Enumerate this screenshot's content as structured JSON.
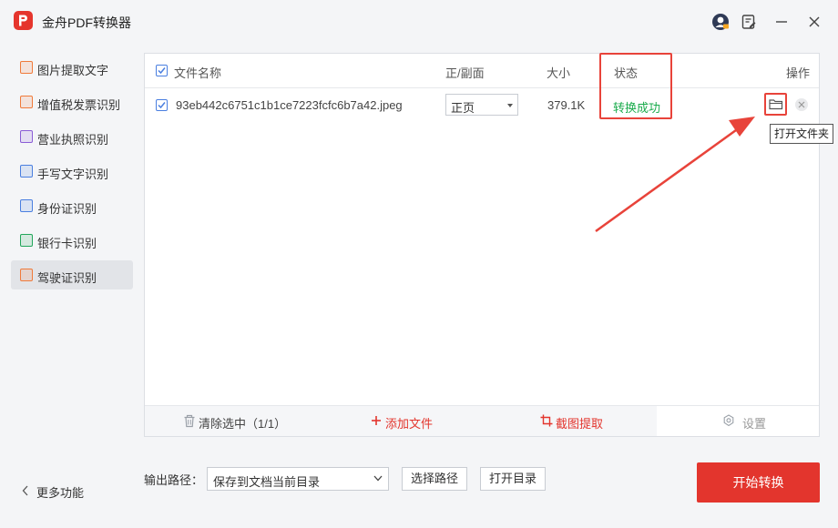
{
  "app": {
    "title": "金舟PDF转换器"
  },
  "colors": {
    "accent": "#e3352d",
    "success": "#1aab4c",
    "checkbox": "#4a7fe0",
    "annotation": "#e8433a"
  },
  "titlebar": {
    "icons": [
      "avatar-icon",
      "feedback-icon",
      "minimize-icon",
      "close-icon"
    ]
  },
  "sidebar": {
    "items": [
      {
        "label": "图片提取文字",
        "icon": "image-text-icon",
        "color": "#f07a3a"
      },
      {
        "label": "增值税发票识别",
        "icon": "invoice-icon",
        "color": "#f07a3a"
      },
      {
        "label": "营业执照识别",
        "icon": "license-icon",
        "color": "#8a5cd6"
      },
      {
        "label": "手写文字识别",
        "icon": "handwriting-icon",
        "color": "#4a7fe0"
      },
      {
        "label": "身份证识别",
        "icon": "id-card-icon",
        "color": "#4a7fe0"
      },
      {
        "label": "银行卡识别",
        "icon": "bank-card-icon",
        "color": "#22a65a"
      },
      {
        "label": "驾驶证识别",
        "icon": "driver-license-icon",
        "color": "#f07a3a"
      }
    ],
    "active_index": 6,
    "more_label": "更多功能"
  },
  "table": {
    "headers": {
      "name": "文件名称",
      "side": "正/副面",
      "size": "大小",
      "status": "状态",
      "actions": "操作"
    },
    "rows": [
      {
        "checked": true,
        "name": "93eb442c6751c1b1ce7223fcfc6b7a42.jpeg",
        "side": "正页",
        "size": "379.1K",
        "status": "转换成功"
      }
    ],
    "tooltip": "打开文件夹"
  },
  "toolbar": {
    "clear_label": "清除选中（1/1）",
    "add_label": "添加文件",
    "crop_label": "截图提取",
    "settings_label": "设置"
  },
  "output": {
    "label": "输出路径：",
    "path_value": "保存到文档当前目录",
    "choose_label": "选择路径",
    "open_label": "打开目录"
  },
  "start_label": "开始转换"
}
